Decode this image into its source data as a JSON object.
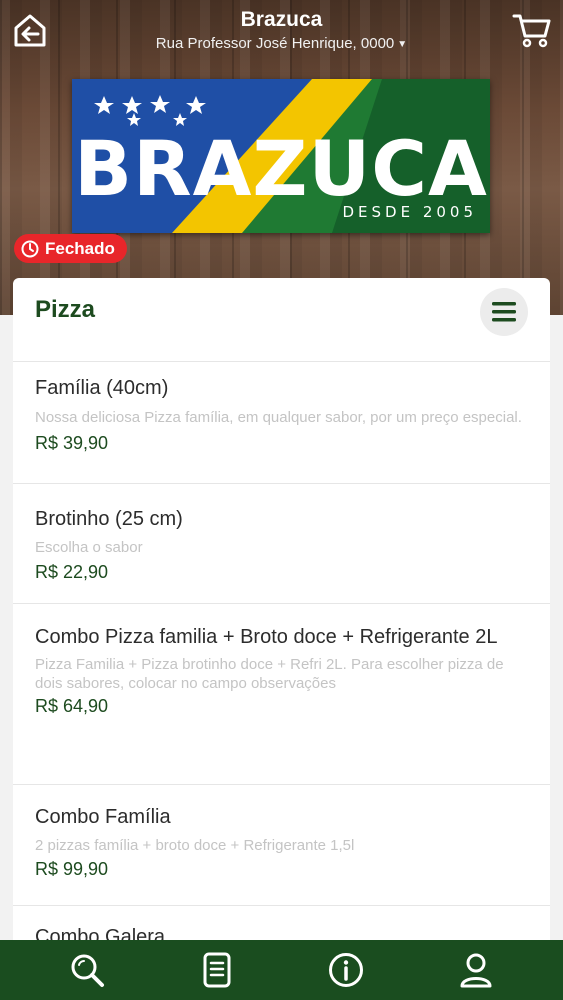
{
  "header": {
    "store_name": "Brazuca",
    "address": "Rua Professor José Henrique, 0000",
    "home_icon": "home-back-icon",
    "cart_icon": "cart-icon"
  },
  "logo": {
    "text": "BRAZUCA",
    "tagline": "DESDE 2005"
  },
  "status": {
    "label": "Fechado",
    "icon": "clock-icon",
    "color": "#e8262a"
  },
  "category": {
    "title": "Pizza",
    "menu_icon": "hamburger-menu-icon"
  },
  "items": [
    {
      "name": "Família (40cm)",
      "description": "Nossa deliciosa Pizza família, em qualquer sabor, por um preço especial.",
      "price": "R$ 39,90"
    },
    {
      "name": "Brotinho (25 cm)",
      "description": "Escolha o sabor",
      "price": "R$ 22,90"
    },
    {
      "name": "Combo Pizza familia + Broto doce + Refrigerante 2L",
      "description": "Pizza Familia + Pizza brotinho doce + Refri 2L. Para escolher pizza de dois sabores, colocar no campo observações",
      "price": "R$ 64,90"
    },
    {
      "name": "Combo Família",
      "description": "2 pizzas família + broto doce + Refrigerante 1,5l",
      "price": "R$ 99,90"
    },
    {
      "name": "Combo Galera",
      "description": "",
      "price": ""
    }
  ],
  "bottom_nav": {
    "icons": [
      "search-icon",
      "menu-list-icon",
      "info-icon",
      "user-icon"
    ]
  },
  "colors": {
    "brand_green": "#1a4d1f",
    "price_green": "#1d4b1f",
    "closed_red": "#e8262a"
  }
}
